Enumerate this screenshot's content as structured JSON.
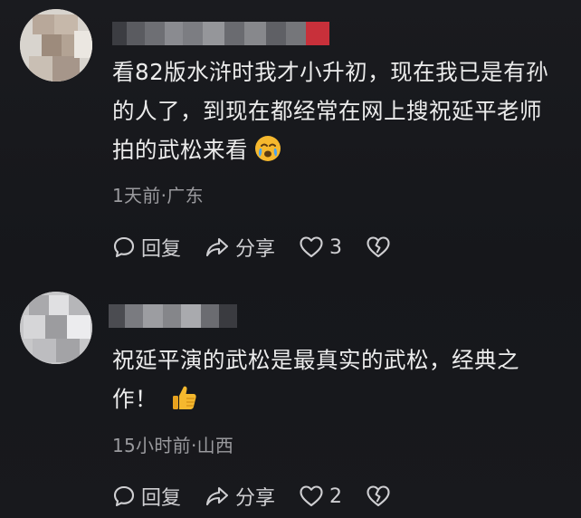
{
  "comments": [
    {
      "text_line1": "看82版水浒时我才小升初，现在我已是有孙",
      "text_line2": "的人了，到现在都经常在网上搜祝延平老师",
      "text_line3": "拍的武松来看",
      "emoji": "crying-face-emoji",
      "meta": "1天前·广东",
      "reply_label": "回复",
      "share_label": "分享",
      "like_count": "3"
    },
    {
      "text_line1": "祝延平演的武松是最真实的武松，经典之",
      "text_line2": "作！",
      "emoji": "thumbs-up-emoji",
      "meta": "15小时前·山西",
      "reply_label": "回复",
      "share_label": "分享",
      "like_count": "2"
    }
  ],
  "icons": {
    "reply": "reply-bubble-icon",
    "share": "share-arrow-icon",
    "like": "heart-icon",
    "dislike": "broken-heart-icon"
  },
  "colors": {
    "background": "#17181c",
    "text": "#ececec",
    "meta": "#9a9a9e",
    "emoji": "#f5b82e"
  }
}
